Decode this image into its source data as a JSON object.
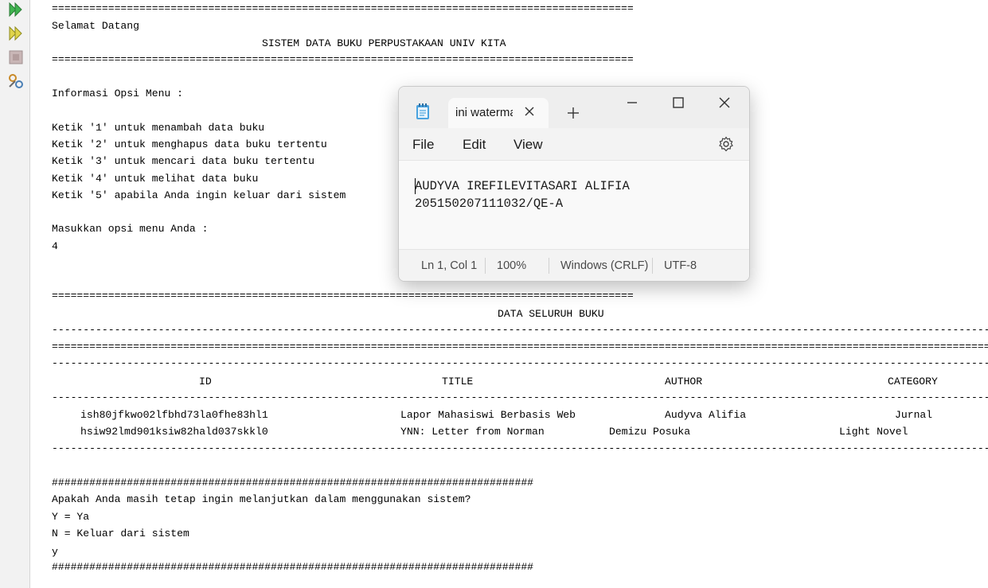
{
  "console": {
    "rule_eq_short": "=============================================================================================",
    "welcome": "Selamat Datang",
    "system_title": "SISTEM DATA BUKU PERPUSTAKAAN UNIV KITA",
    "menu_info_title": "Informasi Opsi Menu :",
    "menu_options": [
      "Ketik '1' untuk menambah data buku",
      "Ketik '2' untuk menghapus data buku tertentu",
      "Ketik '3' untuk mencari data buku tertentu",
      "Ketik '4' untuk melihat data buku",
      "Ketik '5' apabila Anda ingin keluar dari sistem"
    ],
    "prompt": "Masukkan opsi menu Anda :",
    "input_value": "4",
    "table_title": "DATA SELURUH BUKU",
    "rule_dash": "------------------------------------------------------------------------------------------------------------------------------------------------------",
    "rule_eq_long": "======================================================================================================================================================",
    "columns": [
      "ID",
      "TITLE",
      "AUTHOR",
      "CATEGORY"
    ],
    "rows": [
      {
        "id": "ish80jfkwo02lfbhd73la0fhe83hl1",
        "title": "Lapor Mahasiswi Berbasis Web",
        "author": "Audyva Alifia",
        "category": "Jurnal"
      },
      {
        "id": "hsiw92lmd901ksiw82hald037skkl0",
        "title": "YNN: Letter from Norman",
        "author": "Demizu Posuka",
        "category": "Light Novel"
      }
    ],
    "rule_hash": "#############################################################################",
    "continue_question": "Apakah Anda masih tetap ingin melanjutkan dalam menggunakan sistem?",
    "option_yes": "Y = Ya",
    "option_no": "N = Keluar dari sistem",
    "answer": "y"
  },
  "gutter": {
    "icons": [
      "run-icon",
      "run-debug-icon",
      "stop-icon",
      "settings-tools-icon"
    ]
  },
  "notepad": {
    "tab_title": "ini watermark",
    "menu": [
      "File",
      "Edit",
      "View"
    ],
    "content_lines": [
      "AUDYVA IREFILEVITASARI ALIFIA",
      "205150207111032/QE-A"
    ],
    "status": {
      "position": "Ln 1, Col 1",
      "zoom": "100%",
      "line_ending": "Windows (CRLF)",
      "encoding": "UTF-8"
    }
  }
}
